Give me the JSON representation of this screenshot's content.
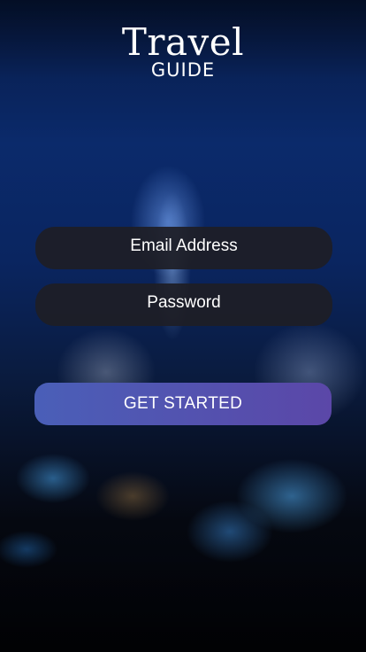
{
  "logo": {
    "title": "Travel",
    "subtitle": "GUIDE"
  },
  "login_form": {
    "email_label": "Email Address",
    "password_label": "Password",
    "submit_label": "GET STARTED"
  },
  "colors": {
    "field_background": "#1e1e26",
    "button_gradient_start": "#4a5fb8",
    "button_gradient_end": "#5b47a8",
    "text": "#ffffff"
  }
}
